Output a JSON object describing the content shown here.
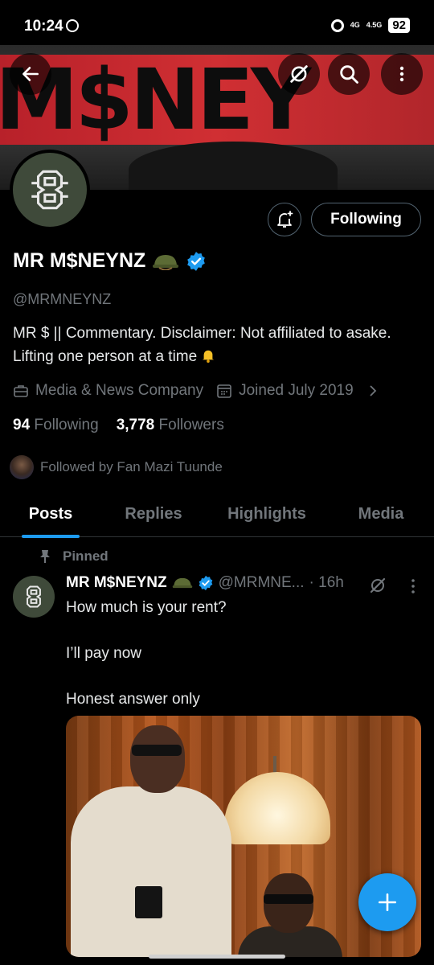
{
  "status_bar": {
    "time": "10:24",
    "network_1": "4G",
    "network_2": "4.5G",
    "battery": "92"
  },
  "banner": {
    "text": "M$NEY"
  },
  "profile": {
    "display_name": "MR M$NEYNZ",
    "handle": "@MRMNEYNZ",
    "bio_line": "MR $ || Commentary. Disclaimer: Not affiliated to asake. Lifting one person at a time",
    "category": "Media & News Company",
    "joined": "Joined July 2019",
    "following_count": "94",
    "following_label": "Following",
    "followers_count": "3,778",
    "followers_label": "Followers",
    "followed_by": "Followed by Fan Mazi Tuunde",
    "follow_button": "Following"
  },
  "tabs": [
    {
      "label": "Posts",
      "active": true
    },
    {
      "label": "Replies",
      "active": false
    },
    {
      "label": "Highlights",
      "active": false
    },
    {
      "label": "Media",
      "active": false
    }
  ],
  "post": {
    "pinned_label": "Pinned",
    "author": "MR M$NEYNZ",
    "handle": "@MRMNE...",
    "time": "· 16h",
    "text": "How much is your rent?\n\nI’ll pay now\n\nHonest answer only"
  },
  "colors": {
    "accent": "#1d9bf0",
    "muted": "#71767b",
    "border": "#536471"
  }
}
